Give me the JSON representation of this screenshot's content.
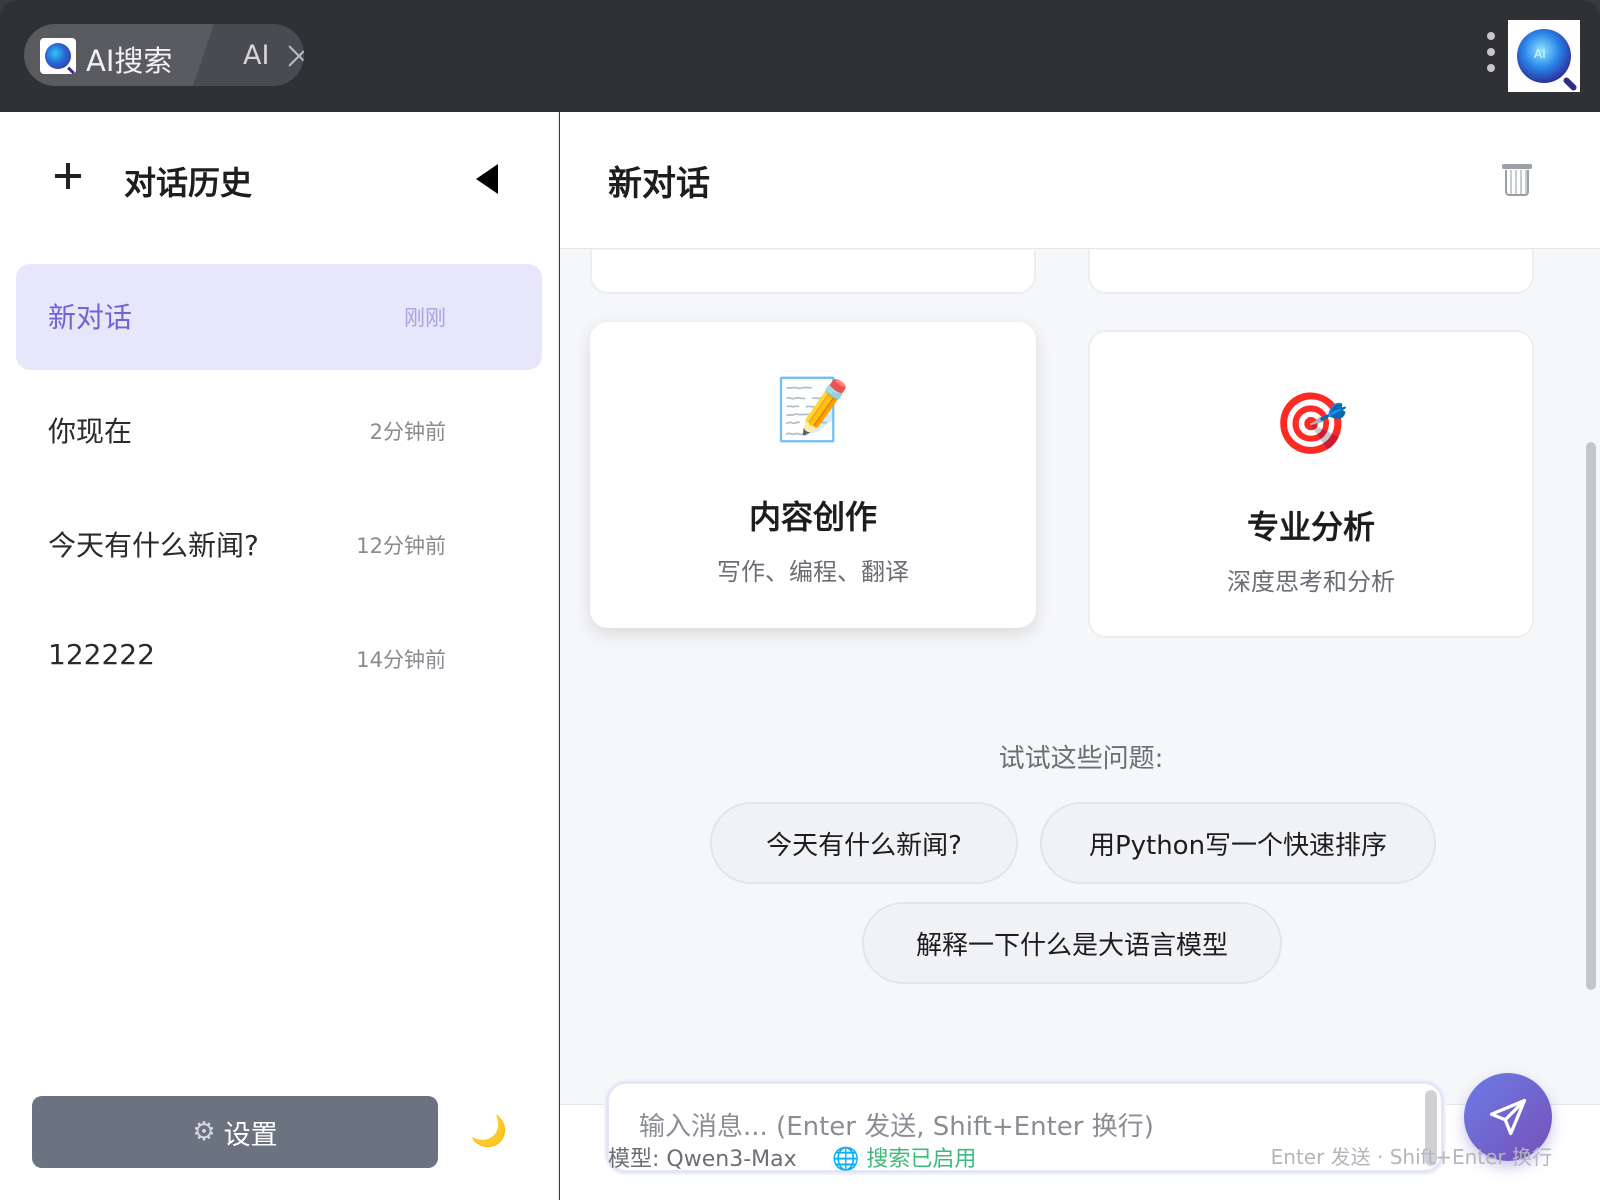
{
  "window": {
    "tab_title": "AI搜索",
    "second_tab": "AI"
  },
  "sidebar": {
    "title": "对话历史",
    "conversations": [
      {
        "title": "新对话",
        "time": "刚刚",
        "active": true
      },
      {
        "title": "你现在",
        "time": "2分钟前"
      },
      {
        "title": "今天有什么新闻?",
        "time": "12分钟前"
      },
      {
        "title": "122222",
        "time": "14分钟前"
      }
    ],
    "settings_label": "设置",
    "settings_icon": "⚙",
    "theme_icon": "🌙"
  },
  "main": {
    "title": "新对话",
    "cards": [
      {
        "emoji": "📝",
        "title": "内容创作",
        "subtitle": "写作、编程、翻译"
      },
      {
        "emoji": "🎯",
        "title": "专业分析",
        "subtitle": "深度思考和分析"
      }
    ],
    "try_label": "试试这些问题:",
    "suggestions": [
      "今天有什么新闻?",
      "用Python写一个快速排序",
      "解释一下什么是大语言模型"
    ]
  },
  "input": {
    "placeholder": "输入消息... (Enter 发送, Shift+Enter 换行)",
    "model_label": "模型: Qwen3-Max",
    "search_status": "🌐 搜索已启用",
    "hint": "Enter 发送 · Shift+Enter 换行"
  },
  "colors": {
    "accent": "#6d64d6",
    "active_bg": "#e8e6fb",
    "settings_bg": "#6b7280",
    "search_green": "#3dbb7a"
  }
}
